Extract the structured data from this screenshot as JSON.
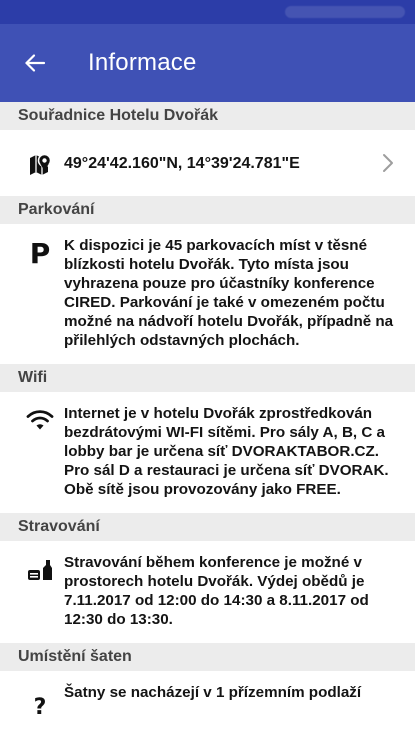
{
  "appbar": {
    "title": "Informace"
  },
  "sections": {
    "coords": {
      "header": "Souřadnice Hotelu Dvořák",
      "value": "49°24'42.160\"N, 14°39'24.781\"E"
    },
    "parking": {
      "header": "Parkování",
      "text": "K dispozici je 45 parkovacích míst v těsné blízkosti hotelu Dvořák. Tyto místa jsou vyhrazena pouze pro účastníky konference CIRED. Parkování je také v omezeném počtu možné na nádvoří hotelu Dvořák, případně na přilehlých odstavných plochách."
    },
    "wifi": {
      "header": "Wifi",
      "text": "Internet je v hotelu Dvořák zprostředkován bezdrátovými WI-FI sítěmi. Pro sály A, B, C a lobby bar je určena síť DVORAKTABOR.CZ. Pro sál D a restauraci je určena síť DVORAK. Obě sítě jsou provozovány jako FREE."
    },
    "food": {
      "header": "Stravování",
      "text": "Stravování během konference je možné v prostorech hotelu Dvořák. Výdej obědů je 7.11.2017 od 12:00 do 14:30 a 8.11.2017 od 12:30 do 13:30."
    },
    "wardrobe": {
      "header": "Umístění šaten",
      "text": "Šatny se nacházejí v 1 přízemním podlaží",
      "icon_glyph": "?"
    }
  },
  "colors": {
    "primary": "#3f51b5",
    "status": "#2c3da8",
    "section_bg": "#ececec"
  },
  "icons": [
    "back-arrow-icon",
    "map-pin-icon",
    "chevron-right-icon",
    "parking-icon",
    "wifi-icon",
    "restaurant-icon",
    "question-icon"
  ]
}
